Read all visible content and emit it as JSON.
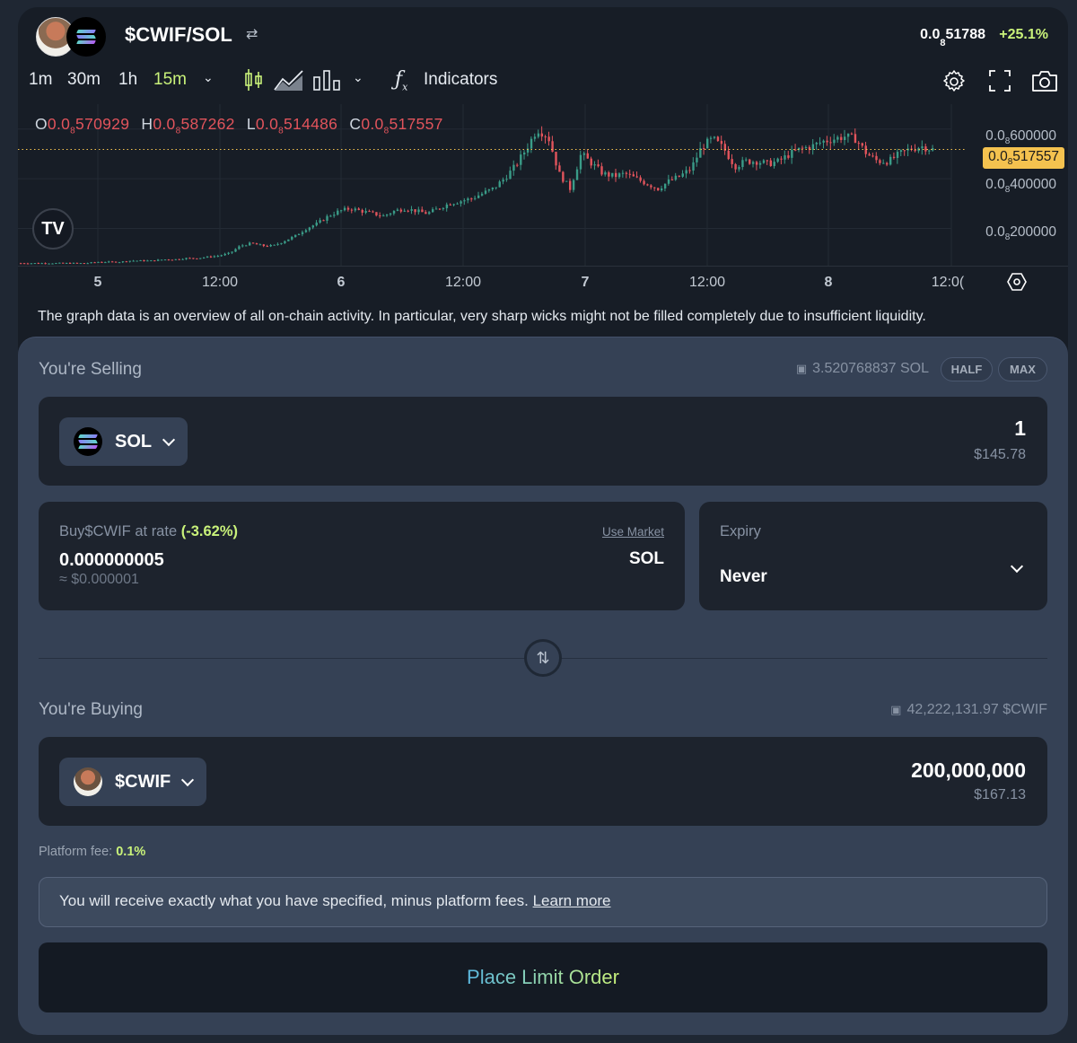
{
  "header": {
    "pair": "$CWIF/SOL",
    "price_prefix": "0.0",
    "price_sub": "8",
    "price_suffix": "51788",
    "change": "+25.1%"
  },
  "toolbar": {
    "timeframes": [
      {
        "label": "1m",
        "active": false
      },
      {
        "label": "30m",
        "active": false
      },
      {
        "label": "1h",
        "active": false
      },
      {
        "label": "15m",
        "active": true
      }
    ],
    "indicators_label": "Indicators"
  },
  "chart_data": {
    "type": "candlestick",
    "ohlc": {
      "o_label": "O",
      "o": [
        "0.0",
        "8",
        "570929"
      ],
      "h_label": "H",
      "h": [
        "0.0",
        "8",
        "587262"
      ],
      "l_label": "L",
      "l": [
        "0.0",
        "8",
        "514486"
      ],
      "c_label": "C",
      "c": [
        "0.0",
        "8",
        "517557"
      ]
    },
    "y_ticks": [
      {
        "prefix": "0.0",
        "sub": "8",
        "digits": "600000",
        "value": 0.6
      },
      {
        "prefix": "0.0",
        "sub": "8",
        "digits": "400000",
        "value": 0.4
      },
      {
        "prefix": "0.0",
        "sub": "8",
        "digits": "200000",
        "value": 0.2
      }
    ],
    "last_price": {
      "prefix": "0.0",
      "sub": "8",
      "digits": "517557",
      "value": 0.517557
    },
    "x_ticks": [
      {
        "label": "5",
        "bold": true
      },
      {
        "label": "12:00",
        "bold": false
      },
      {
        "label": "6",
        "bold": true
      },
      {
        "label": "12:00",
        "bold": false
      },
      {
        "label": "7",
        "bold": true
      },
      {
        "label": "12:00",
        "bold": false
      },
      {
        "label": "8",
        "bold": true
      },
      {
        "label": "12:0(",
        "bold": false
      }
    ],
    "ylim": [
      0.05,
      0.7
    ],
    "series_close_approx": [
      0.06,
      0.06,
      0.06,
      0.06,
      0.06,
      0.06,
      0.06,
      0.065,
      0.065,
      0.065,
      0.07,
      0.07,
      0.07,
      0.075,
      0.075,
      0.08,
      0.08,
      0.085,
      0.09,
      0.1,
      0.13,
      0.14,
      0.13,
      0.13,
      0.15,
      0.17,
      0.2,
      0.22,
      0.25,
      0.27,
      0.28,
      0.27,
      0.26,
      0.25,
      0.27,
      0.28,
      0.27,
      0.26,
      0.28,
      0.3,
      0.31,
      0.32,
      0.34,
      0.36,
      0.4,
      0.45,
      0.52,
      0.6,
      0.57,
      0.42,
      0.36,
      0.5,
      0.46,
      0.42,
      0.41,
      0.42,
      0.4,
      0.38,
      0.36,
      0.39,
      0.41,
      0.44,
      0.53,
      0.56,
      0.52,
      0.45,
      0.47,
      0.47,
      0.46,
      0.47,
      0.5,
      0.52,
      0.53,
      0.55,
      0.56,
      0.57,
      0.56,
      0.5,
      0.47,
      0.47,
      0.5,
      0.52,
      0.53,
      0.517557
    ]
  },
  "disclaimer": "The graph data is an overview of all on-chain activity. In particular, very sharp wicks might not be filled completely due to insufficient liquidity.",
  "selling": {
    "label": "You're Selling",
    "balance": "3.520768837 SOL",
    "half_label": "HALF",
    "max_label": "MAX",
    "token": "SOL",
    "amount": "1",
    "usd": "$145.78"
  },
  "rate": {
    "label_prefix": "Buy$CWIF at rate",
    "delta": "(-3.62%)",
    "use_market": "Use Market",
    "value": "0.000000005",
    "unit": "SOL",
    "usd": "≈ $0.000001"
  },
  "expiry": {
    "label": "Expiry",
    "value": "Never"
  },
  "buying": {
    "label": "You're Buying",
    "balance": "42,222,131.97 $CWIF",
    "token": "$CWIF",
    "amount": "200,000,000",
    "usd": "$167.13"
  },
  "fee": {
    "label": "Platform fee:",
    "value": "0.1%"
  },
  "notice": {
    "text": "You will receive exactly what you have specified, minus platform fees. ",
    "link": "Learn more"
  },
  "cta": "Place Limit Order",
  "colors": {
    "accent_green": "#c9f27a",
    "up": "#3a9c88",
    "down": "#e2545c",
    "last_price_tag": "#f4c24f"
  }
}
